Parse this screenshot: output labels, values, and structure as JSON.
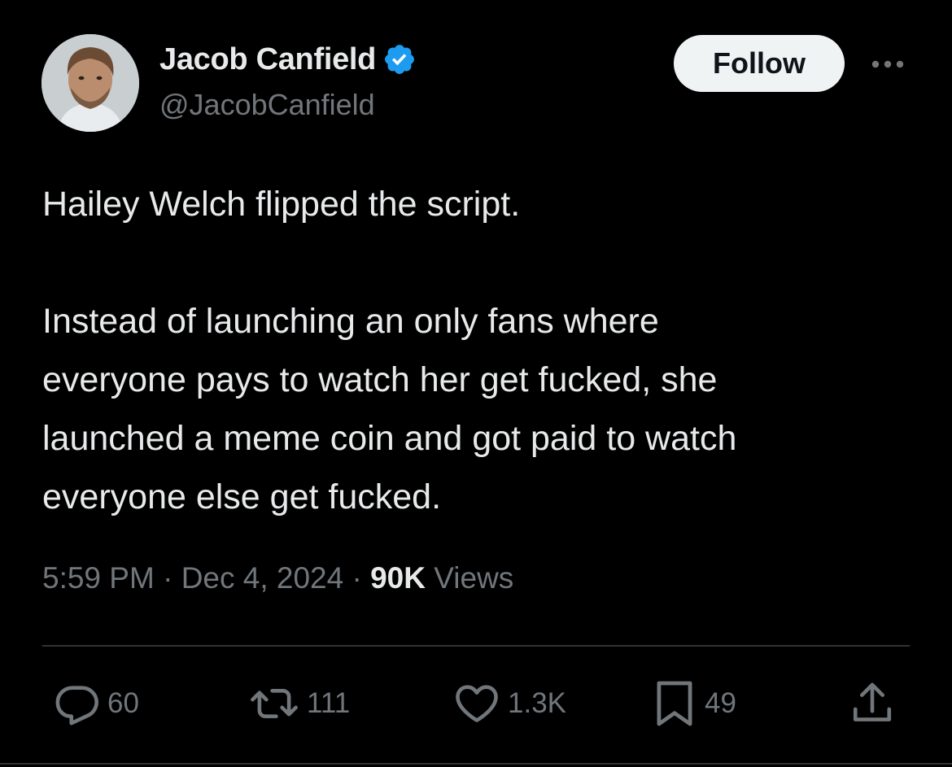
{
  "author": {
    "display_name": "Jacob Canfield",
    "handle": "@JacobCanfield",
    "verified": true,
    "verified_color": "#1d9bf0"
  },
  "follow_button": {
    "label": "Follow"
  },
  "tweet": {
    "paragraphs": [
      "Hailey Welch flipped the script.",
      "Instead of launching an only fans where everyone pays to watch her get fucked, she launched a meme coin and got paid to watch everyone else get fucked."
    ],
    "lines_p2": [
      "Instead of launching an only fans where",
      "everyone pays to watch her get fucked, she",
      "launched a meme coin and got paid to watch",
      "everyone else get fucked."
    ]
  },
  "meta": {
    "time": "5:59 PM",
    "separator": "·",
    "date": "Dec 4, 2024",
    "views_count": "90K",
    "views_label": "Views"
  },
  "actions": {
    "replies": "60",
    "reposts": "111",
    "likes": "1.3K",
    "bookmarks": "49"
  },
  "icons": {
    "reply": "reply-icon",
    "repost": "repost-icon",
    "like": "heart-icon",
    "bookmark": "bookmark-icon",
    "share": "share-icon",
    "more": "more-icon",
    "verified": "verified-badge-icon"
  },
  "colors": {
    "background": "#000000",
    "text": "#e7e9ea",
    "muted": "#71767b",
    "divider": "#2f3336",
    "follow_bg": "#eff3f4"
  }
}
